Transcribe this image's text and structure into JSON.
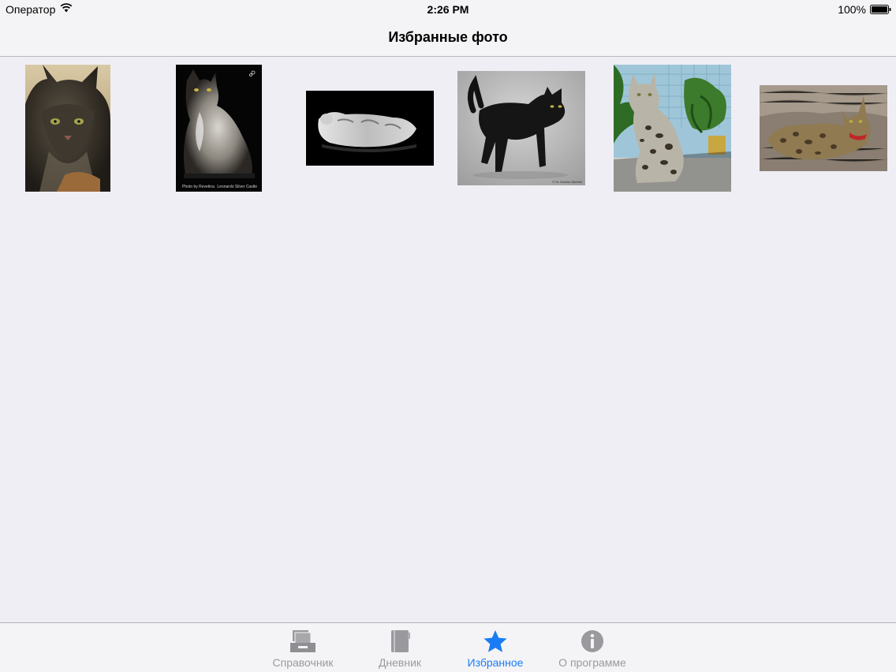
{
  "status_bar": {
    "carrier": "Оператор",
    "time": "2:26 PM",
    "battery": "100%"
  },
  "nav": {
    "title": "Избранные фото"
  },
  "photos": [
    {
      "subject": "maine-coon-tabby"
    },
    {
      "subject": "long-hair-smoke-cat",
      "caption_left": "Photo by Revetina",
      "caption_right": "Leonardo Silver Castle"
    },
    {
      "subject": "silver-cat-lying"
    },
    {
      "subject": "black-cat-walking",
      "credit": "© Dr. Nadine Michèle"
    },
    {
      "subject": "spotted-bengal-cat"
    },
    {
      "subject": "spotted-cat-sofa"
    }
  ],
  "tabbar": {
    "tabs": [
      {
        "label": "Справочник",
        "icon": "archive-icon",
        "active": false
      },
      {
        "label": "Дневник",
        "icon": "notebook-icon",
        "active": false
      },
      {
        "label": "Избранное",
        "icon": "star-icon",
        "active": true
      },
      {
        "label": "О программе",
        "icon": "info-icon",
        "active": false
      }
    ]
  },
  "colors": {
    "accent": "#1a7cf5",
    "inactive": "#9a9a9e",
    "background": "#efeef4",
    "bar": "#f4f4f6"
  }
}
